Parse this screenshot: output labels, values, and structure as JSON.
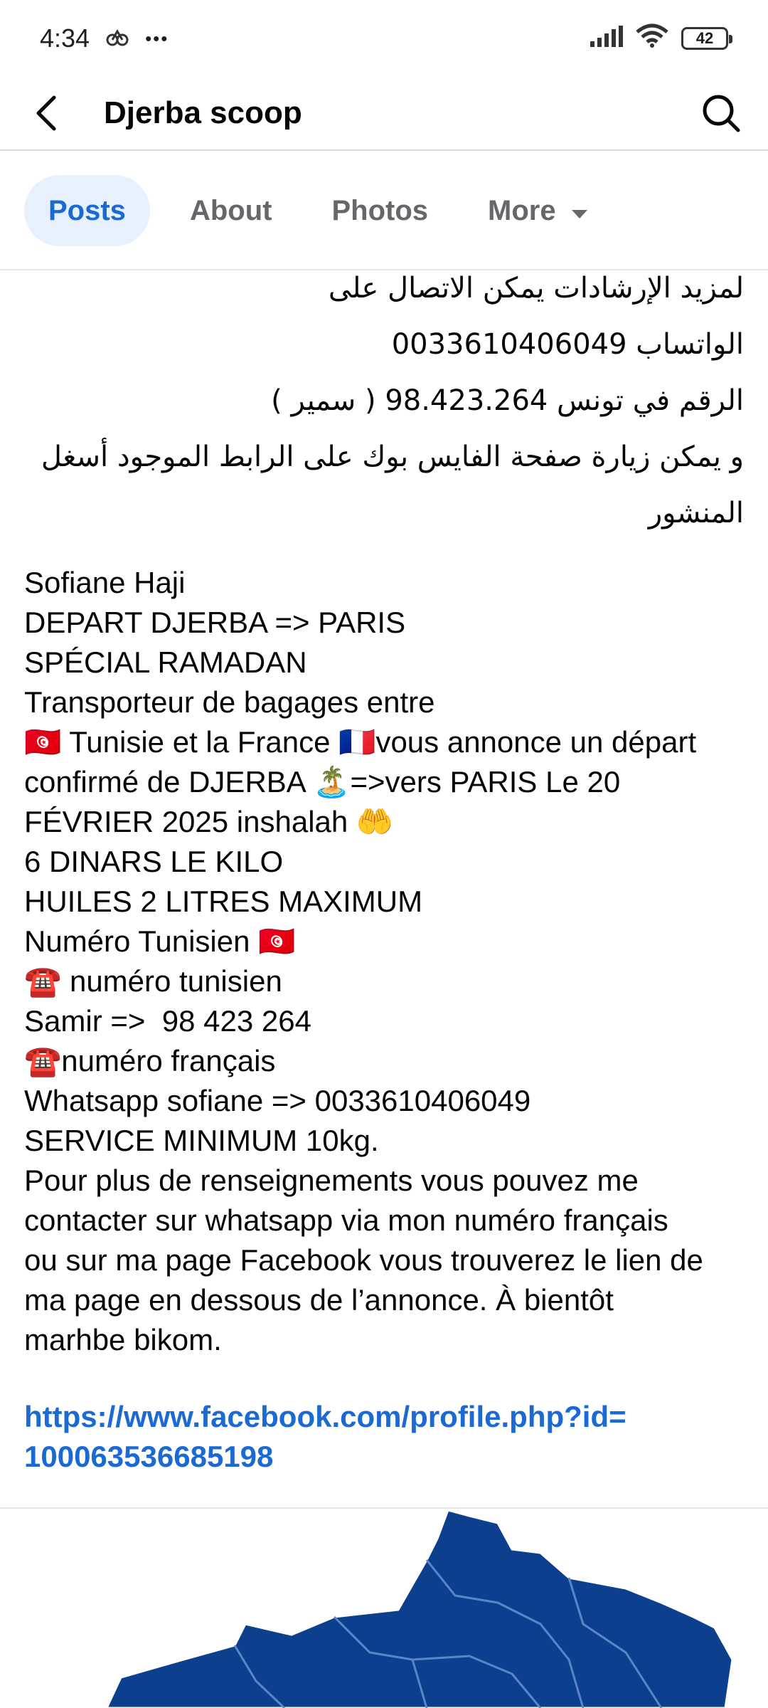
{
  "status_bar": {
    "time": "4:34",
    "dots": "•••",
    "battery": "42"
  },
  "header": {
    "title": "Djerba scoop"
  },
  "tabs": [
    {
      "label": "Posts",
      "active": true
    },
    {
      "label": "About",
      "active": false
    },
    {
      "label": "Photos",
      "active": false
    },
    {
      "label": "More",
      "active": false
    }
  ],
  "post": {
    "arabic_lines": [
      "لمزيد الإرشادات يمكن الاتصال على",
      "الواتساب 0033610406049",
      "الرقم في تونس 98.423.264 ( سمير )",
      "و يمكن زيارة صفحة الفايس بوك على الرابط الموجود أسغل",
      "المنشور"
    ],
    "lines": [
      "Sofiane Haji",
      "DEPART DJERBA => PARIS",
      "SPÉCIAL RAMADAN",
      "Transporteur de bagages entre",
      "🇹🇳 Tunisie et la France 🇫🇷vous annonce un départ",
      "confirmé de DJERBA 🏝️=>vers PARIS Le 20",
      "FÉVRIER 2025 inshalah 🤲",
      "6 DINARS LE KILO",
      "HUILES 2 LITRES MAXIMUM",
      "Numéro Tunisien 🇹🇳",
      "☎️ numéro tunisien",
      "Samir =>  98 423 264",
      "☎️numéro français",
      "Whatsapp sofiane => 0033610406049",
      "SERVICE MINIMUM 10kg.",
      "Pour plus de renseignements vous pouvez me",
      "contacter sur whatsapp via mon numéro français",
      "ou sur ma page Facebook vous trouverez le lien de",
      "ma page en dessous de l’annonce. À bientôt",
      "marhbe bikom."
    ],
    "link_line1": "https://www.facebook.com/profile.php?id=",
    "link_line2": "100063536685198"
  },
  "colors": {
    "accent": "#1b6ad4",
    "map_fill": "#0d3f8f",
    "map_border": "#5b86c6"
  }
}
